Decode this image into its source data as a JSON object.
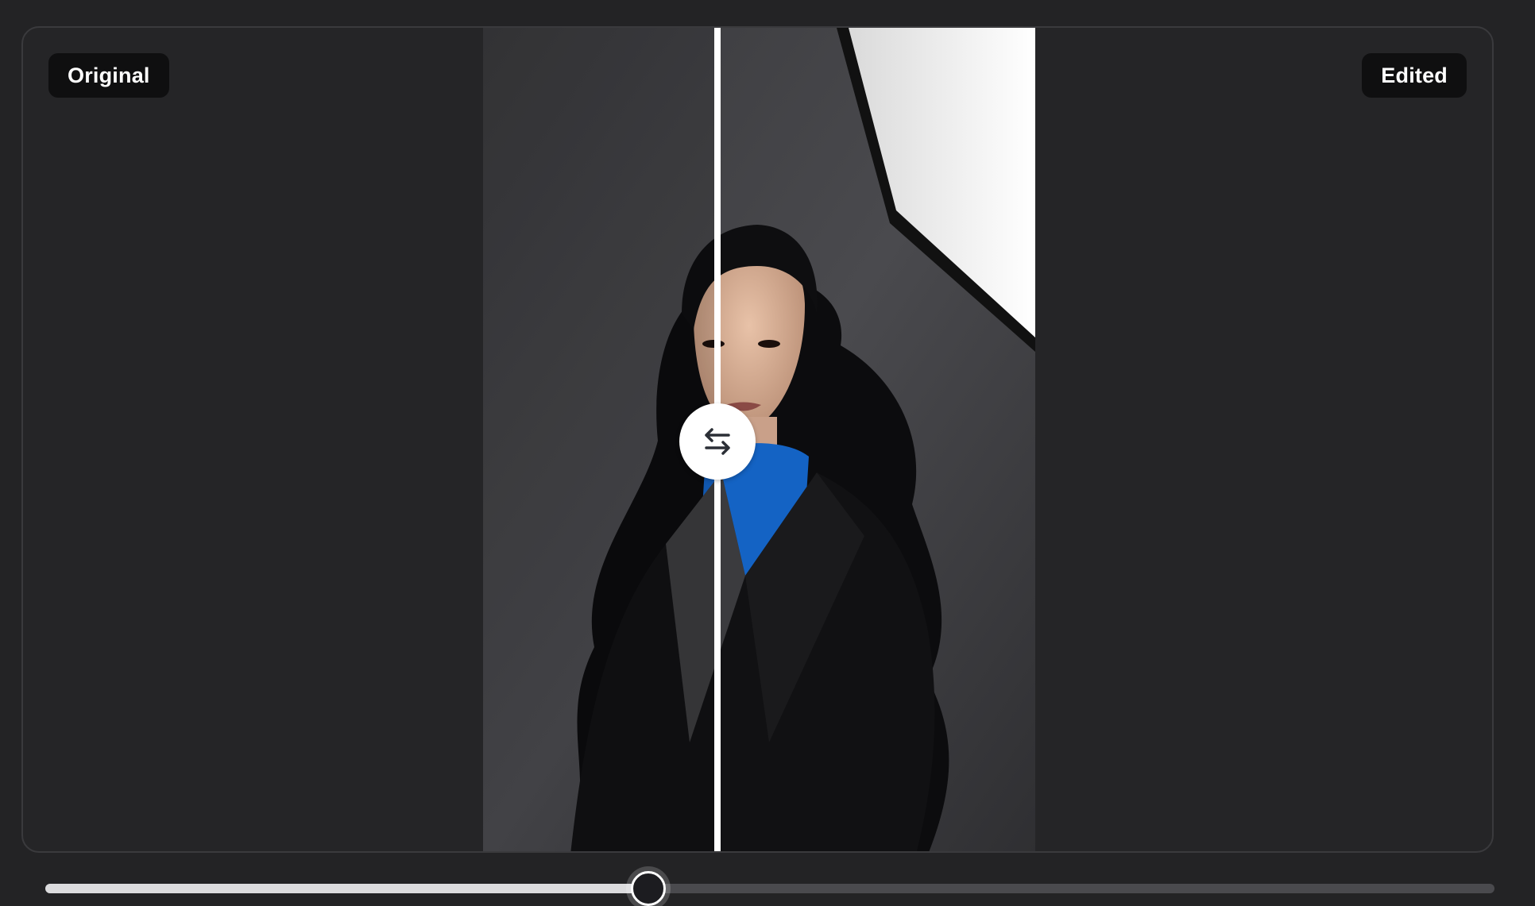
{
  "labels": {
    "original": "Original",
    "edited": "Edited"
  },
  "comparison": {
    "split_percent": 42.4,
    "handle_icon": "swap-horizontal-icon"
  },
  "slider": {
    "value_percent": 41.6
  },
  "colors": {
    "background": "#232325",
    "badge": "#0f0f10",
    "badge_text": "#ffffff",
    "divider": "#ffffff",
    "turtleneck_accent": "#1463c4"
  }
}
